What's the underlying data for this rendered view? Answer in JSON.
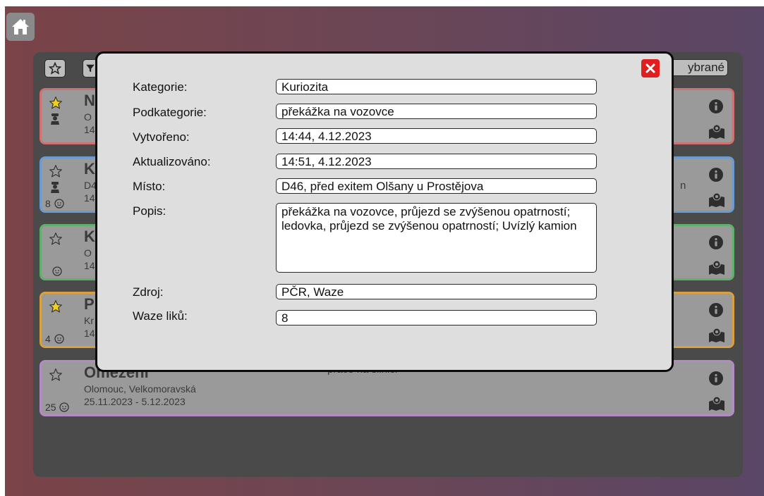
{
  "toolbar": {
    "selected_label": "ybrané"
  },
  "cards": [
    {
      "title": "N",
      "place": "O",
      "dates": "14",
      "sub": "",
      "likes": "",
      "border": "#d07070",
      "starred": true,
      "police": true
    },
    {
      "title": "K",
      "place": "D4",
      "dates": "14",
      "sub": "n",
      "likes": "8",
      "border": "#6a9ad0",
      "starred": false,
      "police": true
    },
    {
      "title": "K",
      "place": "O",
      "dates": "14",
      "sub": "",
      "likes": "",
      "border": "#5fb06a",
      "starred": false,
      "police": false
    },
    {
      "title": "P",
      "place": "Kr",
      "dates": "14",
      "sub": "",
      "likes": "4",
      "border": "#d9a040",
      "starred": true,
      "police": false
    },
    {
      "title": "Omezení",
      "place": "Olomouc, Velkomoravská",
      "dates": "25.11.2023 - 5.12.2023",
      "sub": "práce na silnici",
      "likes": "25",
      "border": "#b48ac4",
      "starred": false,
      "police": false
    }
  ],
  "detail": {
    "kategorie_label": "Kategorie:",
    "kategorie": "Kuriozita",
    "podkategorie_label": "Podkategorie:",
    "podkategorie": "překážka na vozovce",
    "vytvoreno_label": "Vytvořeno:",
    "vytvoreno": "14:44, 4.12.2023",
    "aktualizovano_label": "Aktualizováno:",
    "aktualizovano": "14:51, 4.12.2023",
    "misto_label": "Místo:",
    "misto": "D46, před exitem Olšany u Prostějova",
    "popis_label": "Popis:",
    "popis": "překážka na vozovce, průjezd se zvýšenou opatrností; ledovka, průjezd se zvýšenou opatrností; Uvízlý kamion",
    "zdroj_label": "Zdroj:",
    "zdroj": "PČR, Waze",
    "waze_label": "Waze liků:",
    "waze": "8"
  },
  "colors": {
    "close": "#e01e1e",
    "star_yellow": "#f2d01c"
  },
  "icons": [
    "home-icon",
    "star-icon",
    "filter-icon",
    "police-icon",
    "waze-icon",
    "info-icon",
    "map-icon",
    "close-icon"
  ]
}
